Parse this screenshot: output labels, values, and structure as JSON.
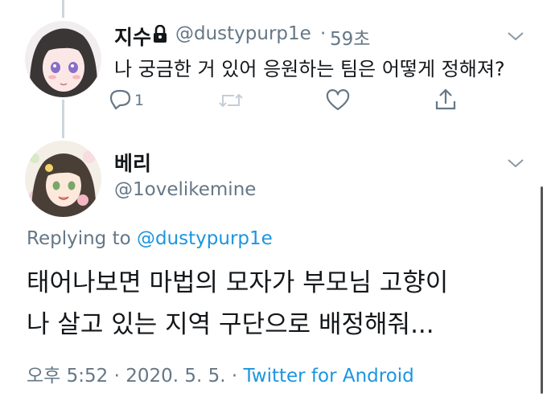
{
  "reply_tweet": {
    "display_name": "지수",
    "handle": "@dustypurp1e",
    "separator": "·",
    "time": "59초",
    "text": "나 궁금한 거 있어 응원하는 팀은 어떻게 정해져?",
    "reply_count": "1",
    "lock_icon": "lock-icon"
  },
  "main_tweet": {
    "display_name": "베리",
    "handle": "@1ovelikemine",
    "replying_prefix": "Replying to",
    "replying_to": "@dustypurp1e",
    "text_line1": "태어나보면 마법의 모자가 부모님 고향이",
    "text_line2": "나 살고 있는 지역 구단으로 배정해줘...",
    "meta_time": "오후 5:52 · 2020. 5. 5. ·",
    "meta_source": "Twitter for Android"
  },
  "colors": {
    "text": "#14171a",
    "muted": "#657786",
    "link": "#1b95e0",
    "thread": "#ccd6dd"
  }
}
